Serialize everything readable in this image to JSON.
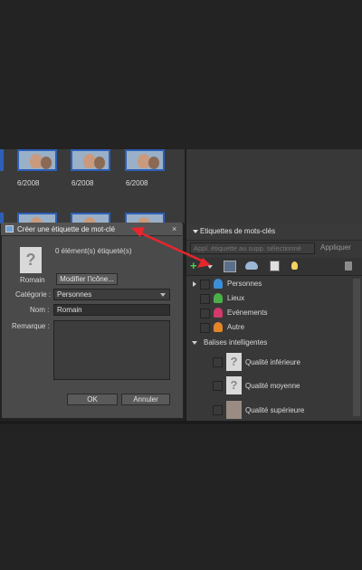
{
  "browser": {
    "dates": [
      "6/2008",
      "6/2008",
      "6/2008"
    ]
  },
  "dialog": {
    "title": "Créer une étiquette de mot-clé",
    "close": "×",
    "element_count": "0 élément(s) étiqueté(s)",
    "icon_caption": "Romain",
    "modify_icon_button": "Modifier l'icône...",
    "category_label": "Catégorie :",
    "category_value": "Personnes",
    "name_label": "Nom :",
    "name_value": "Romain",
    "note_label": "Remarque :",
    "note_value": "",
    "ok_button": "OK",
    "cancel_button": "Annuler"
  },
  "keywords_panel": {
    "header": "Etiquettes de mots-clés",
    "apply_placeholder": "Appl. étiquette au supp. sélectionné",
    "apply_button": "Appliquer",
    "categories": [
      {
        "label": "Personnes",
        "color": "#3b8fd6",
        "icon": "people-icon"
      },
      {
        "label": "Lieux",
        "color": "#4cb04a",
        "icon": "places-icon"
      },
      {
        "label": "Evénements",
        "color": "#d23a6a",
        "icon": "events-icon"
      },
      {
        "label": "Autre",
        "color": "#e3862a",
        "icon": "other-icon"
      }
    ],
    "smart_tags_header": "Balises intelligentes",
    "smart_tags": [
      {
        "label": "Qualité inférieure"
      },
      {
        "label": "Qualité moyenne"
      },
      {
        "label": "Qualité supérieure"
      }
    ]
  },
  "annotation": {
    "arrow_color": "#e8262d"
  }
}
